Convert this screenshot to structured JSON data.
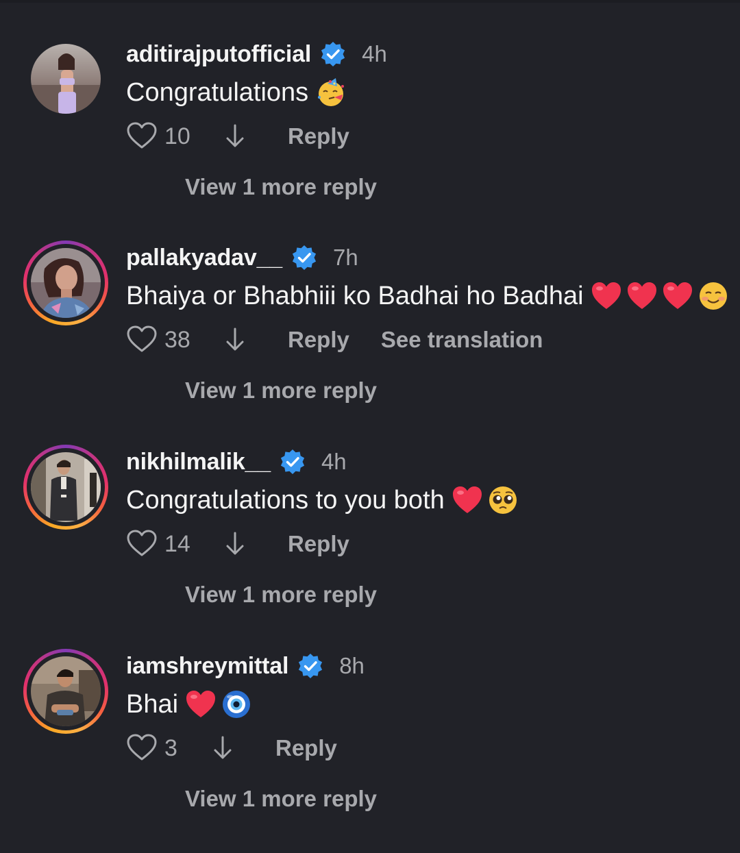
{
  "comments": [
    {
      "username": "aditirajputofficial",
      "verified": true,
      "time": "4h",
      "text": "Congratulations",
      "emojis": [
        "partying-face-emoji"
      ],
      "likes": "10",
      "reply_label": "Reply",
      "translate_label": "",
      "more_replies_label": "View 1 more reply",
      "story_ring": false
    },
    {
      "username": "pallakyadav__",
      "verified": true,
      "time": "7h",
      "text": "Bhaiya or Bhabhiii ko Badhai ho Badhai",
      "emojis": [
        "red-heart-emoji",
        "red-heart-emoji",
        "red-heart-emoji",
        "smiling-face-emoji"
      ],
      "likes": "38",
      "reply_label": "Reply",
      "translate_label": "See translation",
      "more_replies_label": "View 1 more reply",
      "story_ring": true
    },
    {
      "username": "nikhilmalik__",
      "verified": true,
      "time": "4h",
      "text": "Congratulations to you both",
      "emojis": [
        "red-heart-emoji",
        "pleading-face-emoji"
      ],
      "likes": "14",
      "reply_label": "Reply",
      "translate_label": "",
      "more_replies_label": "View 1 more reply",
      "story_ring": true
    },
    {
      "username": "iamshreymittal",
      "verified": true,
      "time": "8h",
      "text": "Bhai",
      "emojis": [
        "red-heart-emoji",
        "nazar-amulet-emoji"
      ],
      "likes": "3",
      "reply_label": "Reply",
      "translate_label": "",
      "more_replies_label": "View 1 more reply",
      "story_ring": true
    }
  ],
  "colors": {
    "background": "#212228",
    "primary_text": "#f4f4f4",
    "secondary_text": "#a8a9ad",
    "verified_badge": "#3897f0",
    "heart": "#f0334f"
  }
}
